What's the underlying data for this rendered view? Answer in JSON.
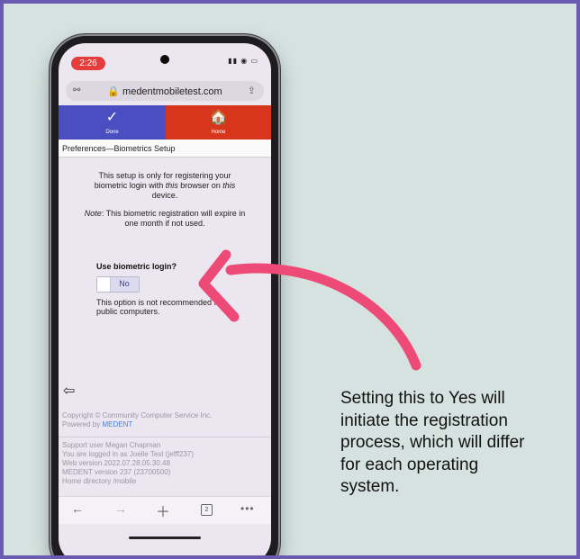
{
  "status": {
    "time": "2:26",
    "icons": "●● • ▭"
  },
  "browser": {
    "key_icon": "key-icon",
    "url": "🔒 medentmobiletest.com",
    "share_icon": "share-icon"
  },
  "nav": {
    "done": {
      "icon": "✓",
      "label": "Done"
    },
    "home": {
      "icon": "🏠",
      "label": "Home"
    },
    "done_color": "#4a4ec0",
    "home_color": "#d7361c"
  },
  "page": {
    "title": "Preferences—Biometrics Setup",
    "intro_1": "This setup is only for registering your biometric login with ",
    "intro_em": "this",
    "intro_2": " browser on ",
    "intro_em2": "this",
    "intro_3": " device.",
    "note_em": "Note",
    "note_text": ": This biometric registration will expire in one month if not used.",
    "bio_label": "Use biometric login?",
    "toggle_value": "No",
    "caution": "This option is not recommended for public computers."
  },
  "footer": {
    "copyright": "Copyright © Community Computer Service Inc.",
    "powered_by": "Powered by ",
    "powered_link": "MEDENT",
    "support_lines": [
      "Support user Megan Chapman",
      "You are logged in as Joelle Test (jefff237)",
      "Web version 2022.07.28.05.30.48",
      "MEDENT version 237 (23700500)",
      "Home directory /mobile"
    ]
  },
  "toolbar": {
    "tabs_count": "2"
  },
  "callout": {
    "text": "Setting this to Yes will initiate the registration process, which will differ for each operating system.",
    "arrow_color": "#ee4a78"
  }
}
